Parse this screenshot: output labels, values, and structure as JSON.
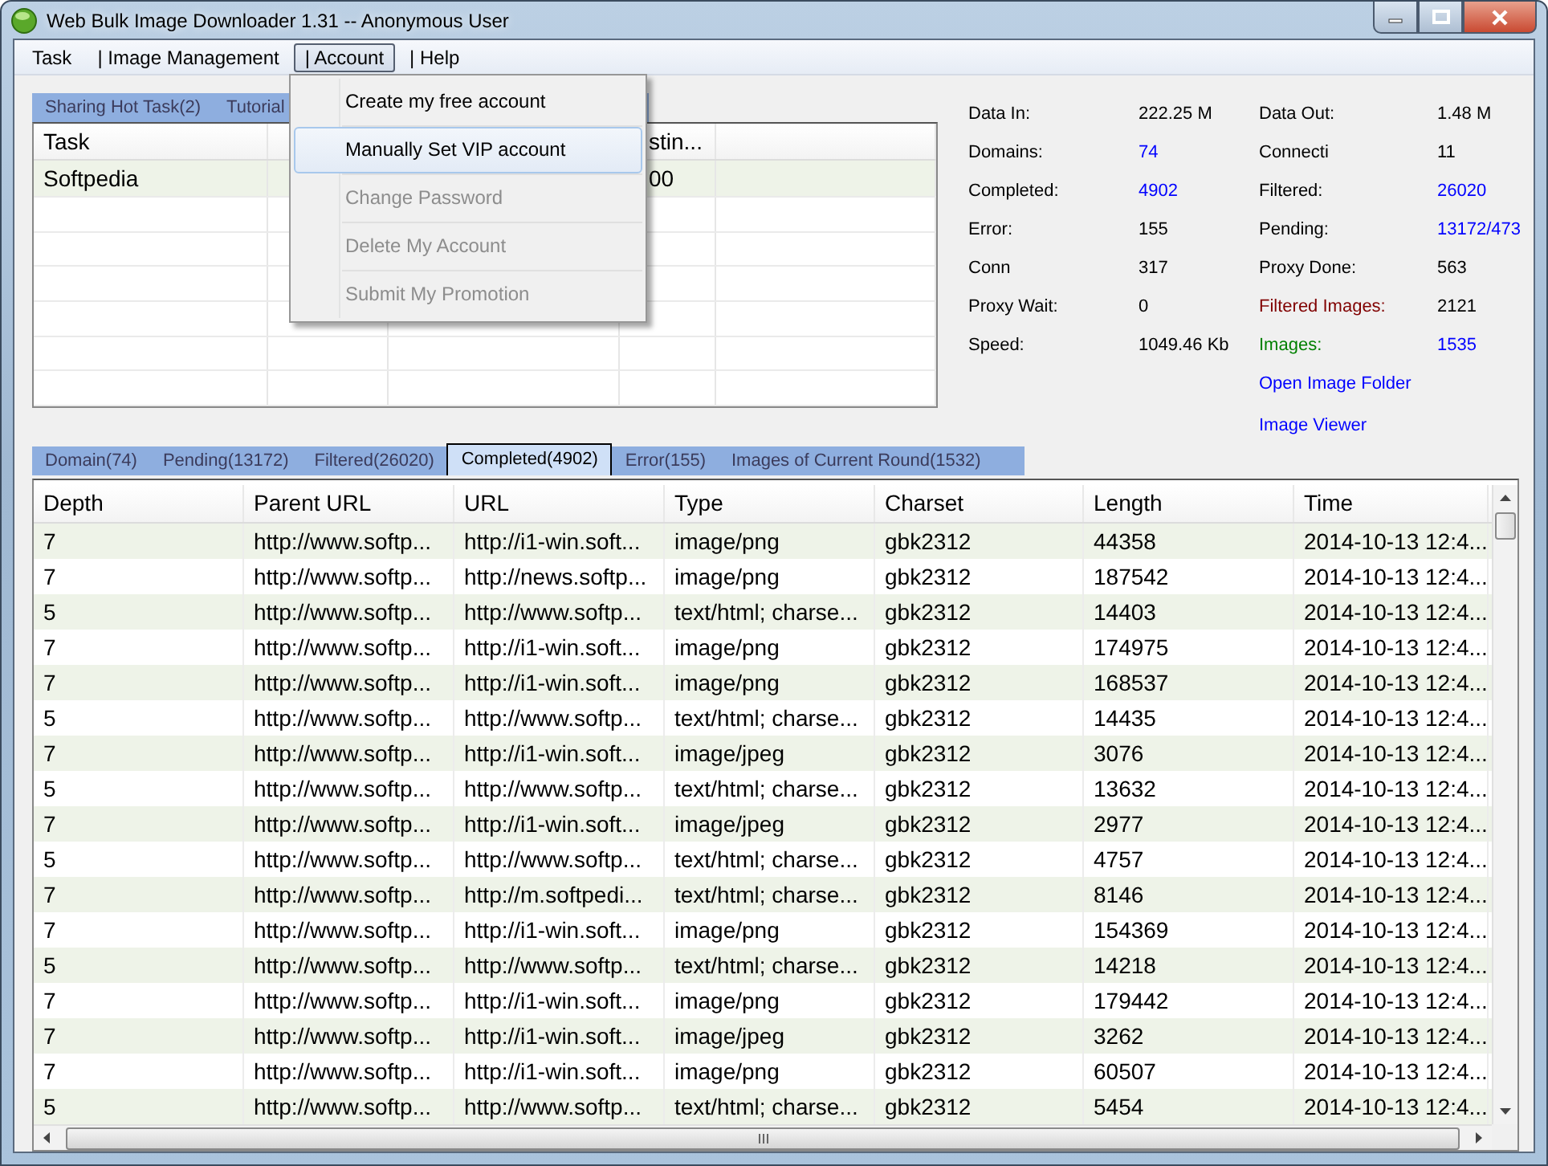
{
  "window": {
    "title": "Web Bulk Image Downloader 1.31 -- Anonymous User"
  },
  "menu": [
    {
      "label": "Task",
      "selected": false
    },
    {
      "label": "| Image Management",
      "selected": false
    },
    {
      "label": "| Account",
      "selected": true
    },
    {
      "label": "| Help",
      "selected": false
    }
  ],
  "dropdown": [
    {
      "label": "Create my free account",
      "disabled": false,
      "selected": false
    },
    {
      "label": "Manually Set VIP account",
      "disabled": false,
      "selected": true
    },
    {
      "label": "Change Password",
      "disabled": true,
      "selected": false
    },
    {
      "label": "Delete My Account",
      "disabled": true,
      "selected": false
    },
    {
      "label": "Submit My Promotion",
      "disabled": true,
      "selected": false
    }
  ],
  "task_tabs": [
    {
      "label": "Sharing Hot Task(2)",
      "selected": false
    },
    {
      "label": "Tutorial",
      "selected": false
    }
  ],
  "task_table": {
    "columns": [
      "Task",
      "stin..."
    ],
    "rows": [
      [
        "Softpedia",
        "00"
      ]
    ]
  },
  "stats_left": [
    {
      "label": {
        "text": "Data In:",
        "color": "#000000"
      },
      "value": {
        "text": "222.25 M",
        "color": "#000000"
      }
    },
    {
      "label": {
        "text": "Domains:",
        "color": "#000000"
      },
      "value": {
        "text": "74",
        "color": "#0000ff"
      }
    },
    {
      "label": {
        "text": "Completed:",
        "color": "#000000"
      },
      "value": {
        "text": "4902",
        "color": "#0000ff"
      }
    },
    {
      "label": {
        "text": "Error:",
        "color": "#000000"
      },
      "value": {
        "text": "155",
        "color": "#000000"
      }
    },
    {
      "label": {
        "text": "Conn",
        "color": "#000000"
      },
      "value": {
        "text": "317",
        "color": "#000000"
      }
    },
    {
      "label": {
        "text": "Proxy Wait:",
        "color": "#000000"
      },
      "value": {
        "text": "0",
        "color": "#000000"
      }
    },
    {
      "label": {
        "text": "Speed:",
        "color": "#000000"
      },
      "value": {
        "text": "1049.46 Kb",
        "color": "#000000"
      }
    }
  ],
  "stats_right": [
    {
      "label": {
        "text": "Data Out:",
        "color": "#000000"
      },
      "value": {
        "text": "1.48 M",
        "color": "#000000"
      }
    },
    {
      "label": {
        "text": "Connecti",
        "color": "#000000"
      },
      "value": {
        "text": "11",
        "color": "#000000"
      }
    },
    {
      "label": {
        "text": "Filtered:",
        "color": "#000000"
      },
      "value": {
        "text": "26020",
        "color": "#0000ff"
      }
    },
    {
      "label": {
        "text": "Pending:",
        "color": "#000000"
      },
      "value": {
        "text": "13172/473",
        "color": "#0000ff"
      }
    },
    {
      "label": {
        "text": "Proxy Done:",
        "color": "#000000"
      },
      "value": {
        "text": "563",
        "color": "#000000"
      }
    },
    {
      "label": {
        "text": "Filtered Images:",
        "color": "#800000"
      },
      "value": {
        "text": "2121",
        "color": "#000000"
      }
    },
    {
      "label": {
        "text": "Images:",
        "color": "#008000"
      },
      "value": {
        "text": "1535",
        "color": "#0000ff"
      }
    }
  ],
  "links": [
    "Open Image Folder",
    "Image Viewer"
  ],
  "result_tabs": [
    {
      "label": "Domain(74)",
      "selected": false
    },
    {
      "label": "Pending(13172)",
      "selected": false
    },
    {
      "label": "Filtered(26020)",
      "selected": false
    },
    {
      "label": "Completed(4902)",
      "selected": true
    },
    {
      "label": "Error(155)",
      "selected": false
    },
    {
      "label": "Images of Current Round(1532)",
      "selected": false
    }
  ],
  "table": {
    "columns": [
      "Depth",
      "Parent URL",
      "URL",
      "Type",
      "Charset",
      "Length",
      "Time"
    ],
    "rows": [
      [
        "7",
        "http://www.softp...",
        "http://i1-win.soft...",
        "image/png",
        "gbk2312",
        "44358",
        "2014-10-13 12:4..."
      ],
      [
        "7",
        "http://www.softp...",
        "http://news.softp...",
        "image/png",
        "gbk2312",
        "187542",
        "2014-10-13 12:4..."
      ],
      [
        "5",
        "http://www.softp...",
        "http://www.softp...",
        "text/html; charse...",
        "gbk2312",
        "14403",
        "2014-10-13 12:4..."
      ],
      [
        "7",
        "http://www.softp...",
        "http://i1-win.soft...",
        "image/png",
        "gbk2312",
        "174975",
        "2014-10-13 12:4..."
      ],
      [
        "7",
        "http://www.softp...",
        "http://i1-win.soft...",
        "image/png",
        "gbk2312",
        "168537",
        "2014-10-13 12:4..."
      ],
      [
        "5",
        "http://www.softp...",
        "http://www.softp...",
        "text/html; charse...",
        "gbk2312",
        "14435",
        "2014-10-13 12:4..."
      ],
      [
        "7",
        "http://www.softp...",
        "http://i1-win.soft...",
        "image/jpeg",
        "gbk2312",
        "3076",
        "2014-10-13 12:4..."
      ],
      [
        "5",
        "http://www.softp...",
        "http://www.softp...",
        "text/html; charse...",
        "gbk2312",
        "13632",
        "2014-10-13 12:4..."
      ],
      [
        "7",
        "http://www.softp...",
        "http://i1-win.soft...",
        "image/jpeg",
        "gbk2312",
        "2977",
        "2014-10-13 12:4..."
      ],
      [
        "5",
        "http://www.softp...",
        "http://www.softp...",
        "text/html; charse...",
        "gbk2312",
        "4757",
        "2014-10-13 12:4..."
      ],
      [
        "7",
        "http://www.softp...",
        "http://m.softpedi...",
        "text/html; charse...",
        "gbk2312",
        "8146",
        "2014-10-13 12:4..."
      ],
      [
        "7",
        "http://www.softp...",
        "http://i1-win.soft...",
        "image/png",
        "gbk2312",
        "154369",
        "2014-10-13 12:4..."
      ],
      [
        "5",
        "http://www.softp...",
        "http://www.softp...",
        "text/html; charse...",
        "gbk2312",
        "14218",
        "2014-10-13 12:4..."
      ],
      [
        "7",
        "http://www.softp...",
        "http://i1-win.soft...",
        "image/png",
        "gbk2312",
        "179442",
        "2014-10-13 12:4..."
      ],
      [
        "7",
        "http://www.softp...",
        "http://i1-win.soft...",
        "image/jpeg",
        "gbk2312",
        "3262",
        "2014-10-13 12:4..."
      ],
      [
        "7",
        "http://www.softp...",
        "http://i1-win.soft...",
        "image/png",
        "gbk2312",
        "60507",
        "2014-10-13 12:4..."
      ],
      [
        "5",
        "http://www.softp...",
        "http://www.softp...",
        "text/html; charse...",
        "gbk2312",
        "5454",
        "2014-10-13 12:4..."
      ]
    ]
  }
}
